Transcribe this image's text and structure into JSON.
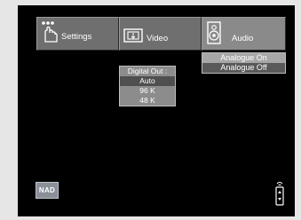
{
  "tabs": {
    "settings": {
      "label": "Settings",
      "icon": "hand-pointer-icon"
    },
    "video": {
      "label": "Video",
      "icon": "tv-icon"
    },
    "audio": {
      "label": "Audio",
      "icon": "speaker-icon"
    }
  },
  "audio_menu": {
    "items": [
      {
        "label": "Analogue On",
        "selected": true
      },
      {
        "label": "Analogue Off",
        "selected": false
      }
    ]
  },
  "digital_out": {
    "title": "Digital Out :",
    "options": [
      {
        "label": "Auto",
        "selected": true
      },
      {
        "label": "96 K",
        "selected": false
      },
      {
        "label": "48 K",
        "selected": false
      }
    ]
  },
  "brand": {
    "logo_text": "NAD"
  },
  "status": {
    "icon": "remote-control-icon"
  },
  "colors": {
    "background": "#000000",
    "tab": "#6f6f6f",
    "tab_active": "#8a8a8a",
    "highlight": "#a7a7a7",
    "selected_option": "#4f4f4f"
  }
}
